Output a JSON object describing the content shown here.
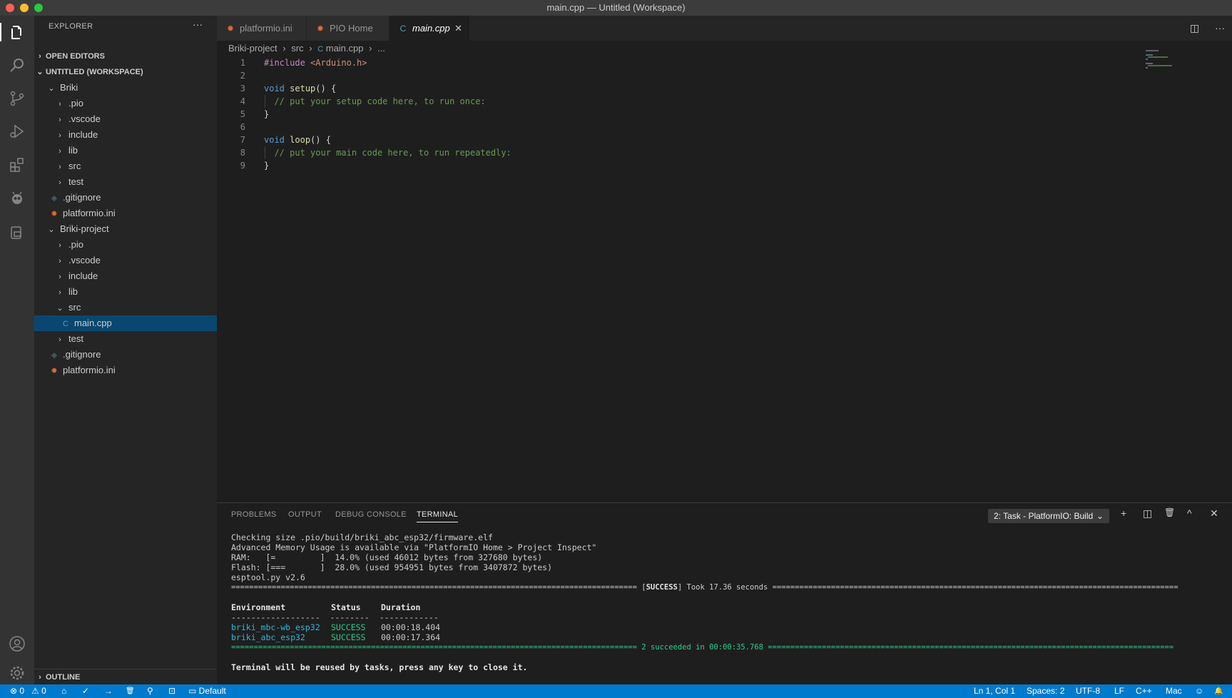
{
  "window": {
    "title": "main.cpp — Untitled (Workspace)"
  },
  "activity_bar": {
    "items": [
      "explorer-icon",
      "search-icon",
      "source-control-icon",
      "run-debug-icon",
      "extensions-icon",
      "platformio-icon",
      "remote-icon"
    ],
    "bottom": [
      "account-icon",
      "settings-gear-icon"
    ]
  },
  "sidebar": {
    "header": "EXPLORER",
    "more": "···",
    "open_editors": "OPEN EDITORS",
    "workspace": "UNTITLED (WORKSPACE)",
    "outline": "OUTLINE",
    "tree": [
      {
        "label": "Briki",
        "chev": "⌄"
      },
      {
        "label": ".pio",
        "chev": "›"
      },
      {
        "label": ".vscode",
        "chev": "›"
      },
      {
        "label": "include",
        "chev": "›"
      },
      {
        "label": "lib",
        "chev": "›"
      },
      {
        "label": "src",
        "chev": "›"
      },
      {
        "label": "test",
        "chev": "›"
      },
      {
        "label": ".gitignore",
        "icon": "◆"
      },
      {
        "label": "platformio.ini",
        "icon": "✹"
      },
      {
        "label": "Briki-project",
        "chev": "⌄"
      },
      {
        "label": ".pio",
        "chev": "›"
      },
      {
        "label": ".vscode",
        "chev": "›"
      },
      {
        "label": "include",
        "chev": "›"
      },
      {
        "label": "lib",
        "chev": "›"
      },
      {
        "label": "src",
        "chev": "⌄"
      },
      {
        "label": "main.cpp",
        "icon": "C"
      },
      {
        "label": "test",
        "chev": "›"
      },
      {
        "label": ".gitignore",
        "icon": "◆"
      },
      {
        "label": "platformio.ini",
        "icon": "✹"
      }
    ]
  },
  "tabs": [
    {
      "label": "platformio.ini",
      "icon": "✹"
    },
    {
      "label": "PIO Home",
      "icon": "✹"
    },
    {
      "label": "main.cpp",
      "icon": "C",
      "close": "✕"
    }
  ],
  "editor_actions": {
    "split": "◫",
    "more": "···"
  },
  "breadcrumb": [
    "Briki-project",
    "src",
    "main.cpp",
    "..."
  ],
  "breadcrumb_sep": "›",
  "code": {
    "line_numbers": [
      "1",
      "2",
      "3",
      "4",
      "5",
      "6",
      "7",
      "8",
      "9"
    ],
    "lines": [
      {
        "p1": "#include",
        "p2": " <Arduino.h>"
      },
      {},
      {
        "kw": "void",
        "fn": "setup",
        "rest": "() {"
      },
      {
        "cm": "  // put your setup code here, to run once:"
      },
      {
        "punc": "}"
      },
      {},
      {
        "kw": "void",
        "fn": "loop",
        "rest": "() {"
      },
      {
        "cm": "  // put your main code here, to run repeatedly:"
      },
      {
        "punc": "}"
      }
    ]
  },
  "panel": {
    "tabs": [
      "PROBLEMS",
      "OUTPUT",
      "DEBUG CONSOLE",
      "TERMINAL"
    ],
    "terminal_select": "2: Task - PlatformIO: Build",
    "actions": {
      "add": "+",
      "split": "◫",
      "trash": "🗑",
      "maximize": "^",
      "close": "✕"
    },
    "terminal": {
      "l1": "Checking size .pio/build/briki_abc_esp32/firmware.elf",
      "l2": "Advanced Memory Usage is available via \"PlatformIO Home > Project Inspect\"",
      "l3": "RAM:   [=         ]  14.0% (used 46012 bytes from 327680 bytes)",
      "l4": "Flash: [===       ]  28.0% (used 954951 bytes from 3407872 bytes)",
      "l5": "esptool.py v2.6",
      "l6_left": "========================================================================================== [",
      "l6_success": "SUCCESS",
      "l6_right": "] Took 17.36 seconds ==========================================================================================",
      "l7_env": "Environment",
      "l7_status": "Status",
      "l7_dur": "Duration",
      "l8": "------------------  --------  ------------",
      "r1_env": "briki_mbc-wb_esp32",
      "r1_status": "SUCCESS",
      "r1_dur": "00:00:18.404",
      "r2_env": "briki_abc_esp32",
      "r2_status": "SUCCESS",
      "r2_dur": "00:00:17.364",
      "l11": "========================================================================================== 2 succeeded in 00:00:35.768 ==========================================================================================",
      "l12": "Terminal will be reused by tasks, press any key to close it."
    }
  },
  "statusbar": {
    "errors": "⊗ 0",
    "warnings": "⚠ 0",
    "home": "⌂",
    "check": "✓",
    "arrow": "→",
    "trash": "🗑",
    "plug": "⚲",
    "term": "⊡",
    "env": "Default",
    "position": "Ln 1, Col 1",
    "spaces": "Spaces: 2",
    "encoding": "UTF-8",
    "eol": "LF",
    "lang": "C++",
    "os": "Mac",
    "feedback": "☺",
    "bell": "🔔"
  }
}
